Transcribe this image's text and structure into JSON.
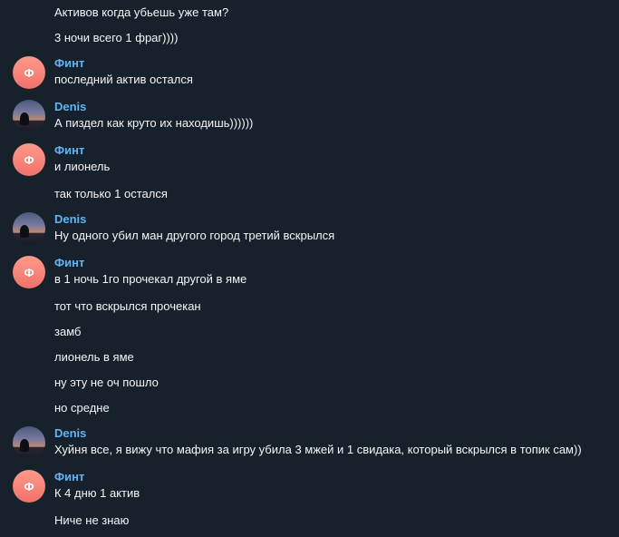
{
  "users": {
    "fint": {
      "name": "Финт",
      "initial": "Ф"
    },
    "denis": {
      "name": "Denis"
    }
  },
  "messages": [
    "Активов когда убьешь уже там?",
    "3 ночи всего 1 фраг))))",
    "последний актив остался",
    "А пиздел как круто их находишь))))))",
    "и лионель",
    "так только 1 остался",
    "Ну одного убил ман другого город третий вскрылся",
    "в 1 ночь 1го прочекал другой в яме",
    "тот что вскрылся прочекан",
    "замб",
    "лионель в яме",
    "ну эту не оч пошло",
    "но средне",
    "Хуйня все, я вижу что мафия за игру убила 3 мжей и 1 свидака, который вскрылся в топик сам))",
    "К 4 дню  1 актив",
    "Ниче не знаю"
  ]
}
